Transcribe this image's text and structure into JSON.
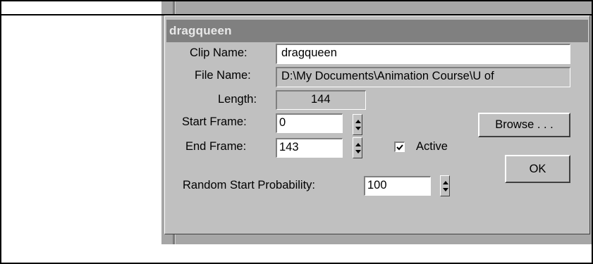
{
  "dialog": {
    "title": "dragqueen",
    "clip_name_label": "Clip Name:",
    "clip_name_value": "dragqueen",
    "file_name_label": "File Name:",
    "file_name_value": "D:\\My Documents\\Animation Course\\U of",
    "length_label": "Length:",
    "length_value": "144",
    "browse_label": "Browse . . .",
    "start_frame_label": "Start Frame:",
    "start_frame_value": "0",
    "end_frame_label": "End Frame:",
    "end_frame_value": "143",
    "active_label": "Active",
    "active_checked": true,
    "ok_label": "OK",
    "random_start_label": "Random Start Probability:",
    "random_start_value": "100"
  },
  "icons": {
    "checkmark": "check-mark-icon",
    "spinner": "spinner-arrows-icon"
  }
}
